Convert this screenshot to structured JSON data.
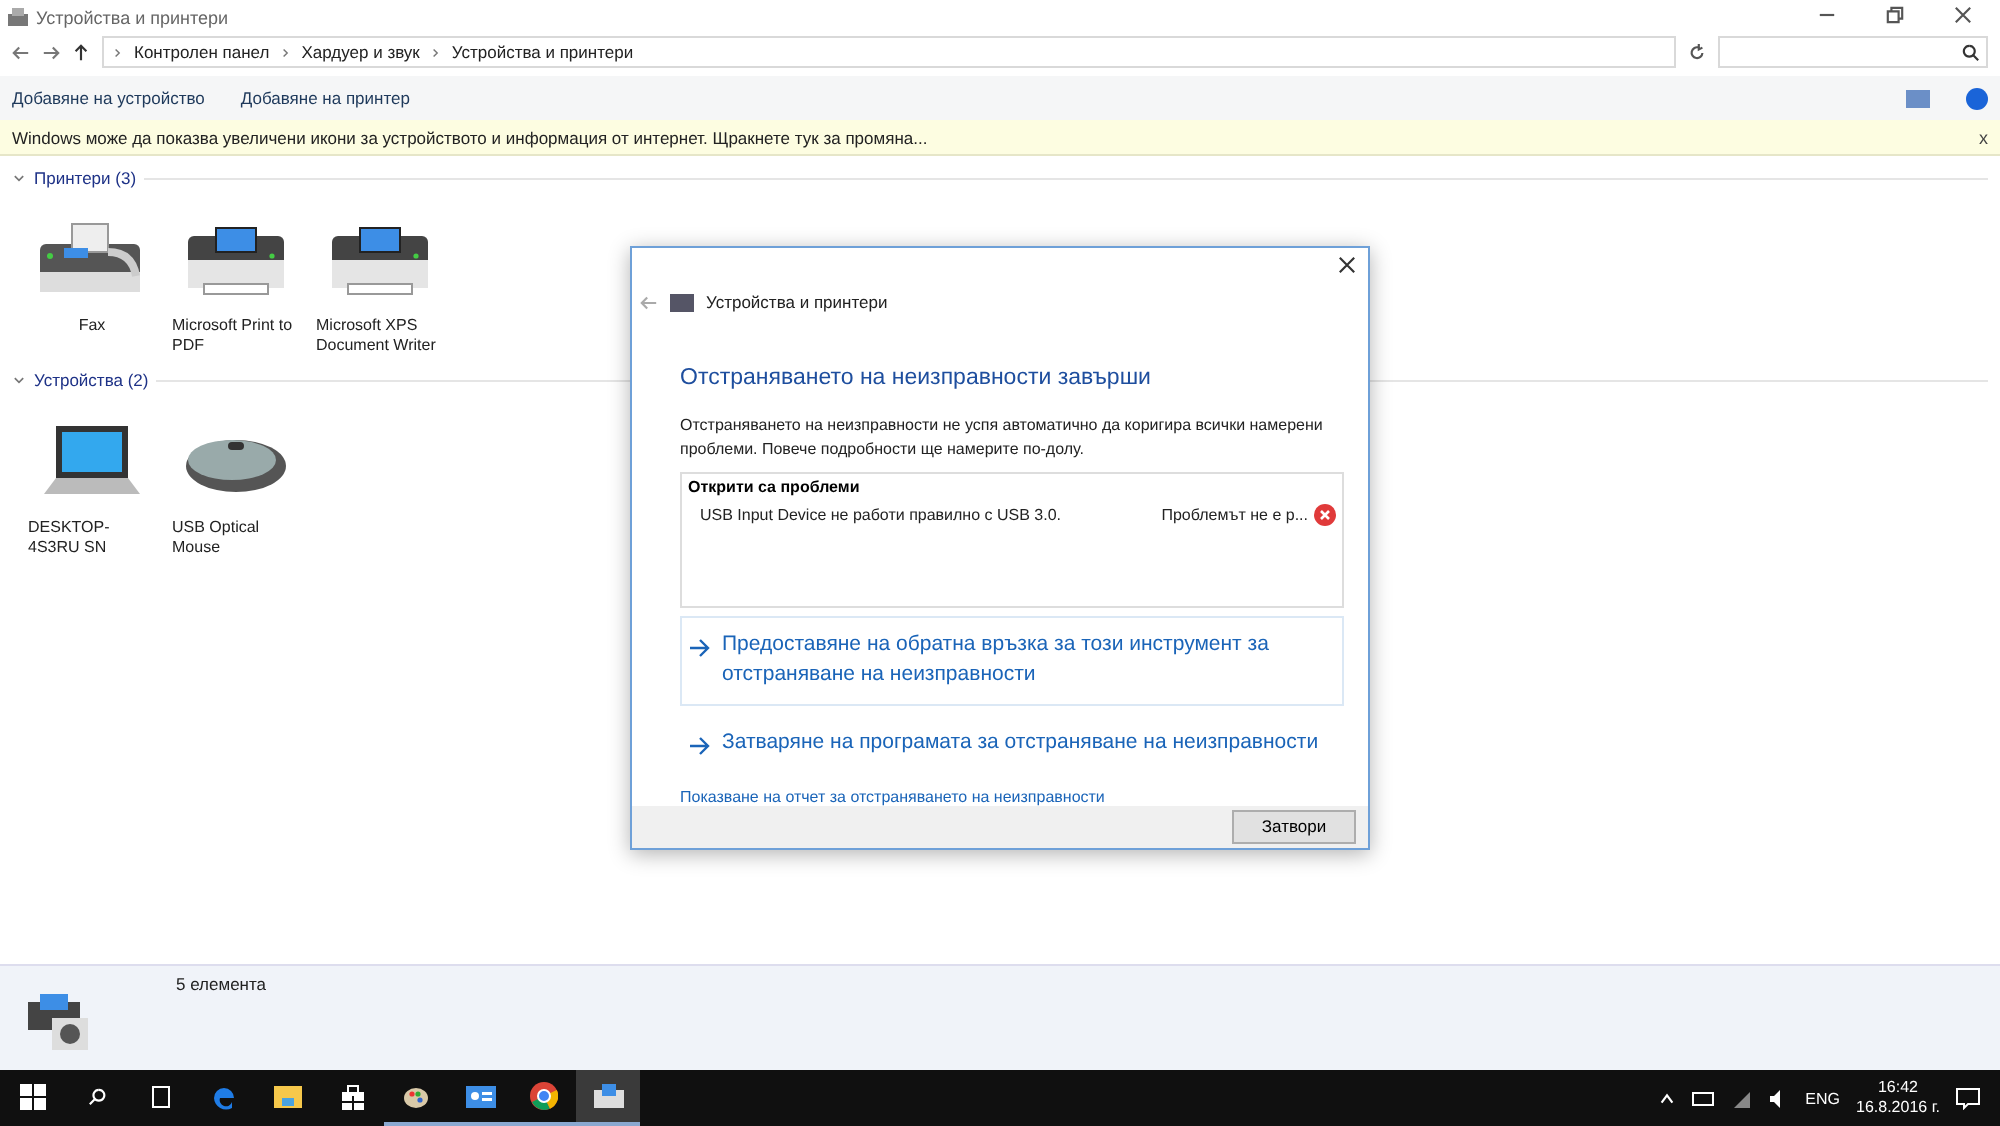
{
  "window": {
    "title": "Устройства и принтери"
  },
  "breadcrumb": [
    "Контролен панел",
    "Хардуер и звук",
    "Устройства и принтери"
  ],
  "toolbar": [
    "Добавяне на устройство",
    "Добавяне на принтер"
  ],
  "info_bar": {
    "text": "Windows може да показва увеличени икони за устройството и информация от интернет. Щракнете тук за промяна...",
    "close": "x"
  },
  "groups": [
    {
      "title": "Принтери (3)",
      "expanded": true,
      "items": [
        {
          "kind": "fax",
          "label": "Fax"
        },
        {
          "kind": "printer",
          "label": "Microsoft Print to PDF"
        },
        {
          "kind": "printer",
          "label": "Microsoft XPS Document Writer"
        }
      ]
    },
    {
      "title": "Устройства (2)",
      "expanded": true,
      "items": [
        {
          "kind": "laptop",
          "label": "DESKTOP-4S3RU SN"
        },
        {
          "kind": "mouse",
          "label": "USB Optical Mouse"
        }
      ]
    }
  ],
  "details": {
    "text": "5 елемента"
  },
  "dialog": {
    "title": "Устройства и принтери",
    "heading": "Отстраняването на неизправности завърши",
    "message": "Отстраняването на неизправности не успя автоматично да коригира всички намерени проблеми. Повече подробности ще намерите по-долу.",
    "problems_title": "Открити са проблеми",
    "problems": [
      {
        "name": "USB Input Device не работи правилно с USB 3.0.",
        "status": "Проблемът не е р..."
      }
    ],
    "actions": [
      {
        "label": "Предоставяне на обратна връзка за този инструмент за отстраняване на неизправности",
        "selected": true
      },
      {
        "label": "Затваряне на програмата за отстраняване на неизправности",
        "selected": false
      }
    ],
    "report_link": "Показване на отчет за отстраняването на неизправности",
    "button": "Затвори"
  },
  "taskbar": {
    "apps": [
      {
        "kind": "edge",
        "open": false,
        "selected": false
      },
      {
        "kind": "explorer",
        "open": false,
        "selected": false
      },
      {
        "kind": "store",
        "open": false,
        "selected": false
      },
      {
        "kind": "paint",
        "open": true,
        "selected": false
      },
      {
        "kind": "contacts",
        "open": true,
        "selected": false
      },
      {
        "kind": "chrome",
        "open": true,
        "selected": false
      },
      {
        "kind": "devices",
        "open": true,
        "selected": true
      }
    ],
    "language": "ENG",
    "time": "16:42",
    "date": "16.8.2016 г."
  }
}
